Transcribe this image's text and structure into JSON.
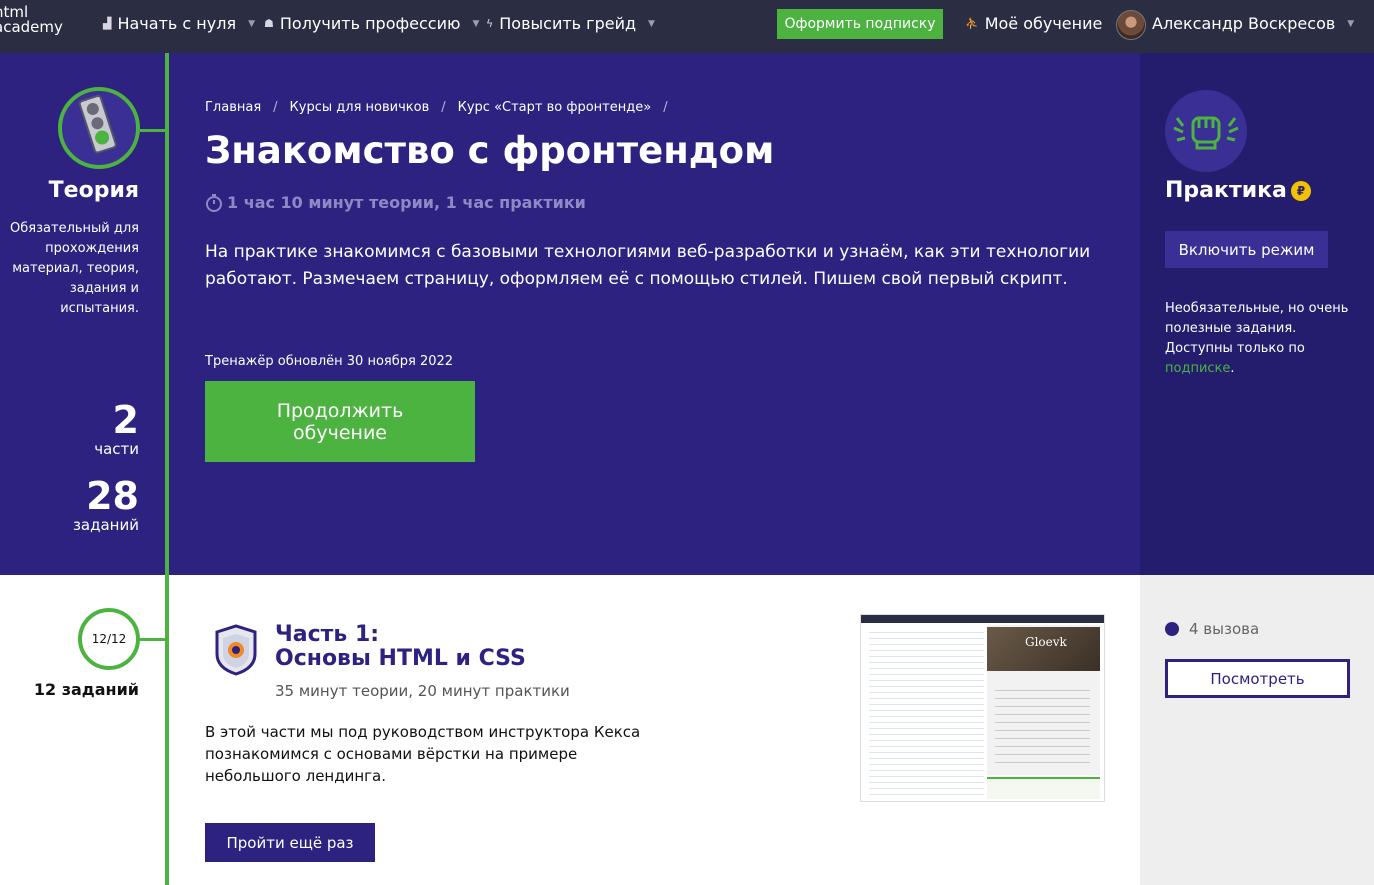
{
  "topbar": {
    "logo_line1": "html",
    "logo_line2": "academy",
    "nav": [
      {
        "label": "Начать с нуля",
        "icon": "bar-chart-icon"
      },
      {
        "label": "Получить профессию",
        "icon": "graduation-cap-icon"
      },
      {
        "label": "Повысить грейд",
        "icon": "lightning-icon"
      }
    ],
    "subscribe_label": "Оформить подписку",
    "my_learning_label": "Моё обучение",
    "user_name": "Александр Воскресов"
  },
  "theory": {
    "title": "Теория",
    "description": "Обязательный для прохождения материал, теория, задания и испытания.",
    "parts_count": "2",
    "parts_label": "части",
    "tasks_count": "28",
    "tasks_label": "заданий"
  },
  "course": {
    "breadcrumbs": [
      "Главная",
      "Курсы для новичков",
      "Курс «Старт во фронтенде»"
    ],
    "title": "Знакомство с фронтендом",
    "duration": "1 час 10 минут теории, 1 час практики",
    "description": "На практике знакомимся с базовыми технологиями веб-разработки и узнаём, как эти технологии работают. Размечаем страницу, оформляем её с помощью стилей. Пишем свой первый скрипт.",
    "updated": "Тренажёр обновлён 30 ноября 2022",
    "continue_label": "Продолжить обучение"
  },
  "practice": {
    "title": "Практика",
    "ruble_symbol": "₽",
    "mode_button": "Включить режим",
    "note_text": "Необязательные, но очень полезные задания. Доступны только по",
    "note_link": "подписке",
    "note_end": "."
  },
  "part1": {
    "progress": "12/12",
    "tasks_label": "12 заданий",
    "title_line1": "Часть 1:",
    "title_line2": "Основы HTML и CSS",
    "duration": "35 минут теории, 20 минут практики",
    "description": "В этой части мы под руководством инструктора Кекса познакомимся с основами вёрстки на примере небольшого лендинга.",
    "again_label": "Пройти ещё раз",
    "preview_title": "Gloevk",
    "calls_label": "4 вызова",
    "look_label": "Посмотреть"
  },
  "colors": {
    "accent_green": "#4cb240",
    "brand_purple": "#2d2280",
    "topbar": "#2b2d42",
    "ruble_gold": "#f2c200"
  }
}
